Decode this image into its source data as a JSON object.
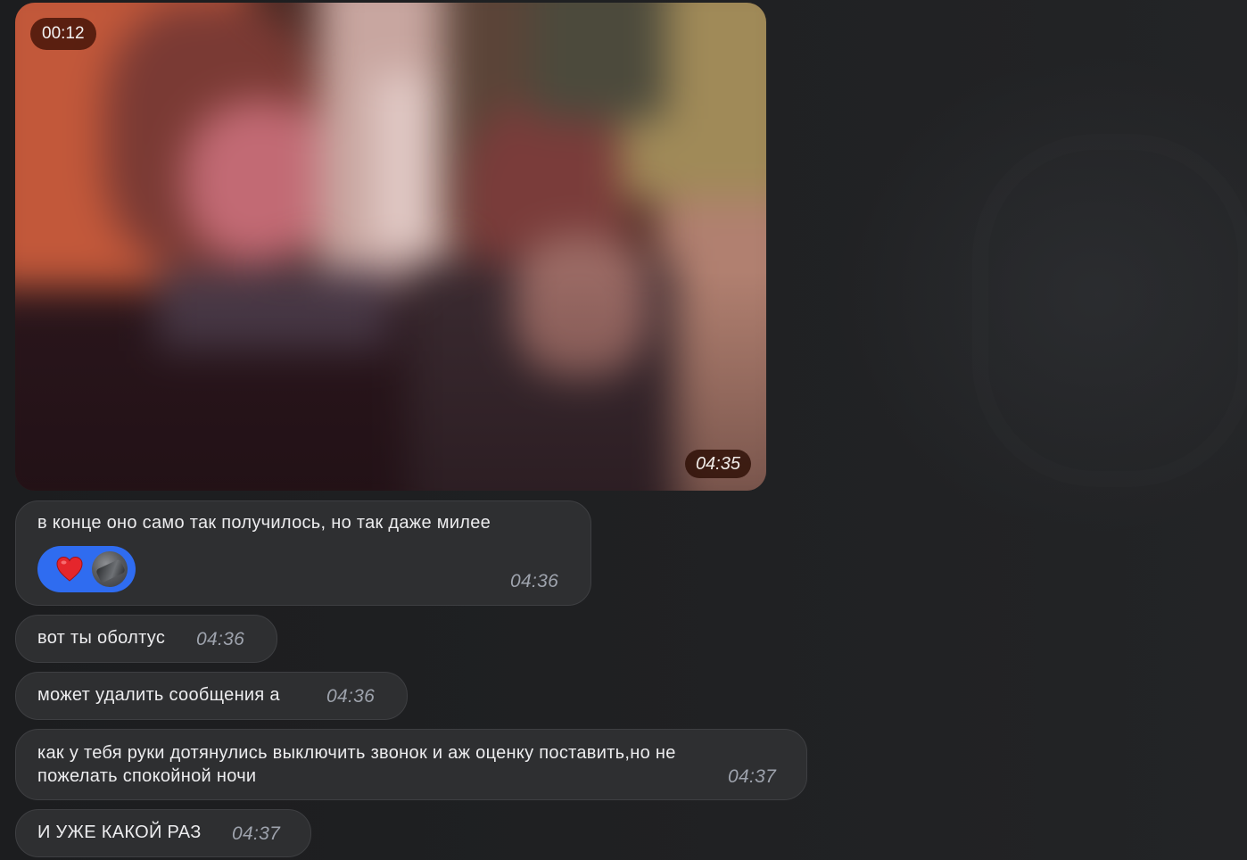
{
  "media": {
    "duration": "00:12",
    "time": "04:35"
  },
  "messages": [
    {
      "text": "в конце оно само так получилось, но так даже милее",
      "time": "04:36",
      "reaction": {
        "emoji": "❤️",
        "icon": "heart-icon",
        "color": "#2f6cf0"
      }
    },
    {
      "text": "вот ты оболтус",
      "time": "04:36"
    },
    {
      "text": "может удалить сообщения а",
      "time": "04:36"
    },
    {
      "text": "как у тебя руки дотянулись выключить звонок и аж оценку поставить,но не\nпожелать спокойной ночи",
      "time": "04:37"
    },
    {
      "text": "И УЖЕ КАКОЙ РАЗ",
      "time": "04:37"
    }
  ]
}
